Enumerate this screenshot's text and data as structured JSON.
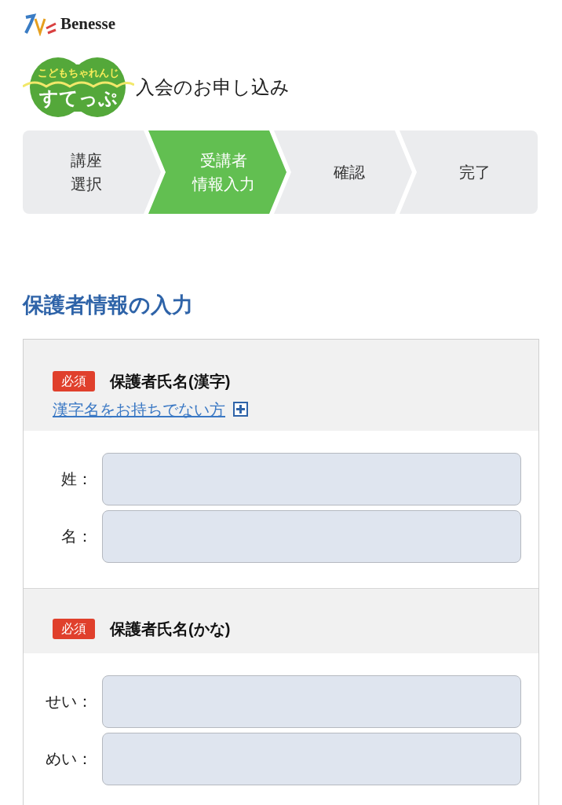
{
  "brand": {
    "name": "Benesse"
  },
  "product": {
    "tagline": "こどもちゃれんじ",
    "name": "すてっぷ",
    "title": "入会のお申し込み"
  },
  "steps": [
    {
      "lines": [
        "講座",
        "選択"
      ],
      "selected": false
    },
    {
      "lines": [
        "受講者",
        "情報入力"
      ],
      "selected": true
    },
    {
      "lines": [
        "確認"
      ],
      "selected": false
    },
    {
      "lines": [
        "完了"
      ],
      "selected": false
    }
  ],
  "heading": "保護者情報の入力",
  "sections": [
    {
      "badge": "必須",
      "title": "保護者氏名(漢字)",
      "link": "漢字名をお持ちでない方",
      "fields": [
        {
          "label": "姓："
        },
        {
          "label": "名："
        }
      ]
    },
    {
      "badge": "必須",
      "title": "保護者氏名(かな)",
      "fields": [
        {
          "label": "せい："
        },
        {
          "label": "めい："
        }
      ]
    }
  ]
}
